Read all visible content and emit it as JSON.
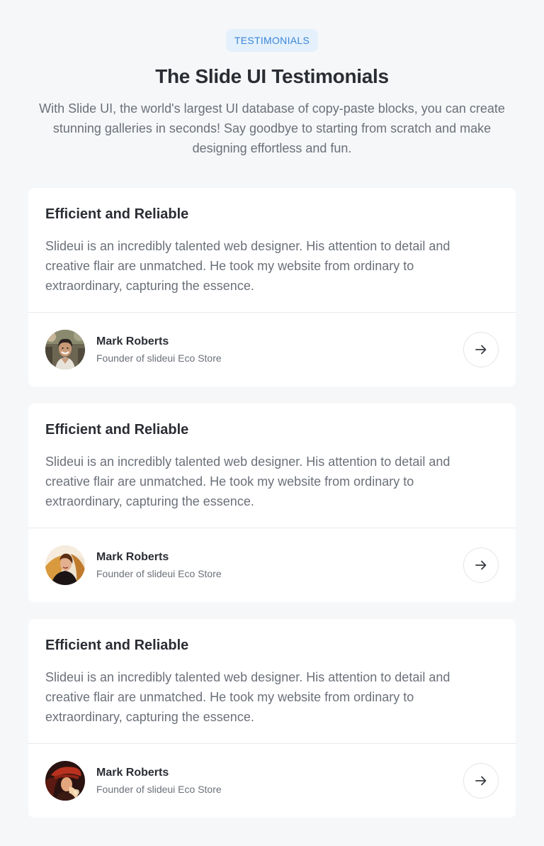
{
  "header": {
    "badge": "TESTIMONIALS",
    "title": "The Slide UI Testimonials",
    "subtitle": "With Slide UI, the world's largest UI database of copy-paste blocks, you can create stunning galleries in seconds! Say goodbye to starting from scratch and make designing effortless and fun."
  },
  "testimonials": [
    {
      "title": "Efficient and Reliable",
      "text": "Slideui is an incredibly talented web designer. His attention to detail and creative flair are unmatched. He took my website from ordinary to extraordinary, capturing the essence.",
      "author": "Mark Roberts",
      "role": "Founder of slideui Eco Store",
      "avatar_icon": "person-photo-smiling-man",
      "arrow_icon": "arrow-right-icon"
    },
    {
      "title": "Efficient and Reliable",
      "text": "Slideui is an incredibly talented web designer. His attention to detail and creative flair are unmatched. He took my website from ordinary to extraordinary, capturing the essence.",
      "author": "Mark Roberts",
      "role": "Founder of slideui Eco Store",
      "avatar_icon": "person-photo-woman-golden-hair",
      "arrow_icon": "arrow-right-icon"
    },
    {
      "title": "Efficient and Reliable",
      "text": "Slideui is an incredibly talented web designer. His attention to detail and creative flair are unmatched. He took my website from ordinary to extraordinary, capturing the essence.",
      "author": "Mark Roberts",
      "role": "Founder of slideui Eco Store",
      "avatar_icon": "person-photo-red-hat",
      "arrow_icon": "arrow-right-icon"
    }
  ],
  "colors": {
    "page_background": "#f6f7f9",
    "badge_background": "#e4f0fb",
    "badge_text": "#3a86d8",
    "heading": "#2a2d33",
    "body_text": "#6b7079",
    "divider": "#e8eaee"
  }
}
